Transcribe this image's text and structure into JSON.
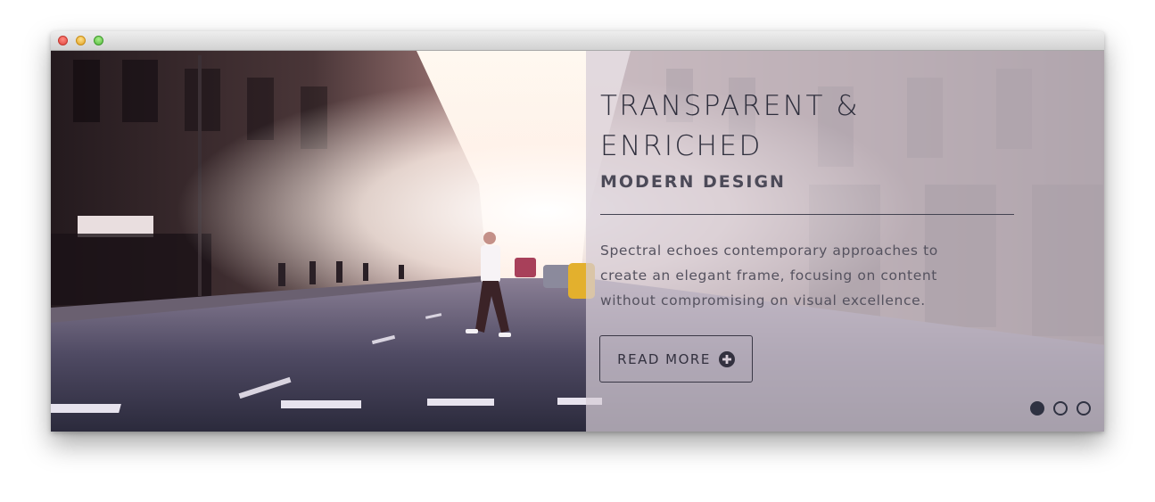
{
  "window": {
    "controls": [
      "close",
      "minimize",
      "maximize"
    ]
  },
  "hero": {
    "headline_line1": "TRANSPARENT &",
    "headline_line2": "ENRICHED",
    "subheading": "MODERN DESIGN",
    "body": "Spectral echoes contemporary approaches to create an elegant frame, focusing on content without compromising on visual excellence.",
    "button_label": "READ MORE",
    "button_icon": "plus-circle-icon"
  },
  "slider": {
    "total_slides": 3,
    "active_slide": 1
  },
  "colors": {
    "text_dark": "#2e2e3c",
    "overlay": "#d7cdd7",
    "dot_active": "#2f3242"
  }
}
